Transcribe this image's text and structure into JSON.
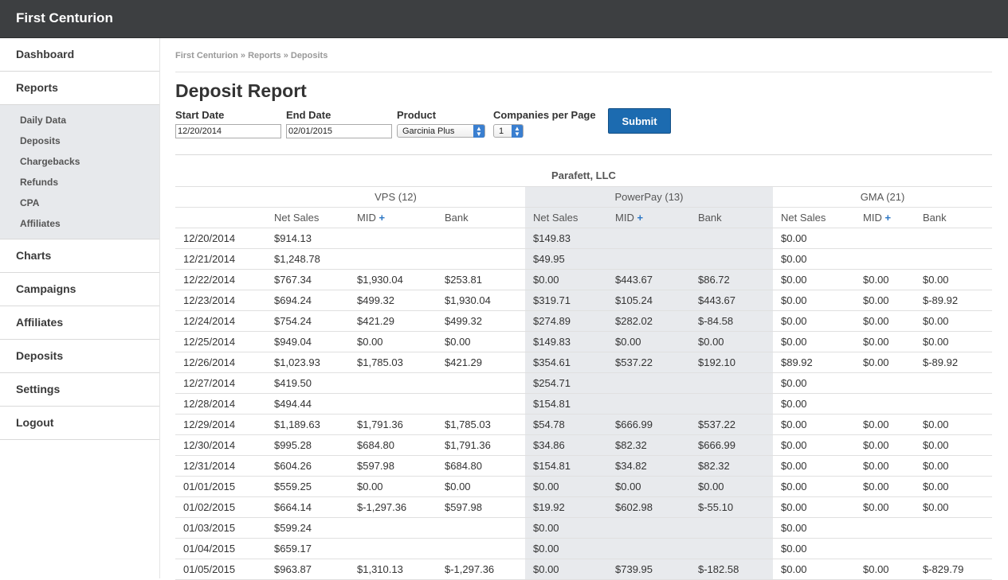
{
  "app": {
    "title": "First Centurion"
  },
  "sidebar": {
    "items": [
      {
        "label": "Dashboard"
      },
      {
        "label": "Reports"
      },
      {
        "label": "Charts"
      },
      {
        "label": "Campaigns"
      },
      {
        "label": "Affiliates"
      },
      {
        "label": "Deposits"
      },
      {
        "label": "Settings"
      },
      {
        "label": "Logout"
      }
    ],
    "subitems": [
      {
        "label": "Daily Data"
      },
      {
        "label": "Deposits"
      },
      {
        "label": "Chargebacks"
      },
      {
        "label": "Refunds"
      },
      {
        "label": "CPA"
      },
      {
        "label": "Affiliates"
      }
    ]
  },
  "breadcrumb": {
    "home": "First Centurion",
    "sep": " » ",
    "reports": "Reports",
    "current": "Deposits"
  },
  "page": {
    "title": "Deposit Report"
  },
  "filters": {
    "start_label": "Start Date",
    "start_value": "12/20/2014",
    "end_label": "End Date",
    "end_value": "02/01/2015",
    "product_label": "Product",
    "product_value": "Garcinia Plus",
    "companies_label": "Companies per Page",
    "companies_value": "1",
    "submit_label": "Submit"
  },
  "table": {
    "company": "Parafett, LLC",
    "groups": [
      "VPS (12)",
      "PowerPay (13)",
      "GMA (21)"
    ],
    "columns": {
      "net": "Net Sales",
      "mid": "MID",
      "plus": "+",
      "bank": "Bank"
    },
    "rows": [
      [
        "12/20/2014",
        "$914.13",
        "",
        "",
        "$149.83",
        "",
        "",
        "$0.00",
        "",
        ""
      ],
      [
        "12/21/2014",
        "$1,248.78",
        "",
        "",
        "$49.95",
        "",
        "",
        "$0.00",
        "",
        ""
      ],
      [
        "12/22/2014",
        "$767.34",
        "$1,930.04",
        "$253.81",
        "$0.00",
        "$443.67",
        "$86.72",
        "$0.00",
        "$0.00",
        "$0.00"
      ],
      [
        "12/23/2014",
        "$694.24",
        "$499.32",
        "$1,930.04",
        "$319.71",
        "$105.24",
        "$443.67",
        "$0.00",
        "$0.00",
        "$-89.92"
      ],
      [
        "12/24/2014",
        "$754.24",
        "$421.29",
        "$499.32",
        "$274.89",
        "$282.02",
        "$-84.58",
        "$0.00",
        "$0.00",
        "$0.00"
      ],
      [
        "12/25/2014",
        "$949.04",
        "$0.00",
        "$0.00",
        "$149.83",
        "$0.00",
        "$0.00",
        "$0.00",
        "$0.00",
        "$0.00"
      ],
      [
        "12/26/2014",
        "$1,023.93",
        "$1,785.03",
        "$421.29",
        "$354.61",
        "$537.22",
        "$192.10",
        "$89.92",
        "$0.00",
        "$-89.92"
      ],
      [
        "12/27/2014",
        "$419.50",
        "",
        "",
        "$254.71",
        "",
        "",
        "$0.00",
        "",
        ""
      ],
      [
        "12/28/2014",
        "$494.44",
        "",
        "",
        "$154.81",
        "",
        "",
        "$0.00",
        "",
        ""
      ],
      [
        "12/29/2014",
        "$1,189.63",
        "$1,791.36",
        "$1,785.03",
        "$54.78",
        "$666.99",
        "$537.22",
        "$0.00",
        "$0.00",
        "$0.00"
      ],
      [
        "12/30/2014",
        "$995.28",
        "$684.80",
        "$1,791.36",
        "$34.86",
        "$82.32",
        "$666.99",
        "$0.00",
        "$0.00",
        "$0.00"
      ],
      [
        "12/31/2014",
        "$604.26",
        "$597.98",
        "$684.80",
        "$154.81",
        "$34.82",
        "$82.32",
        "$0.00",
        "$0.00",
        "$0.00"
      ],
      [
        "01/01/2015",
        "$559.25",
        "$0.00",
        "$0.00",
        "$0.00",
        "$0.00",
        "$0.00",
        "$0.00",
        "$0.00",
        "$0.00"
      ],
      [
        "01/02/2015",
        "$664.14",
        "$-1,297.36",
        "$597.98",
        "$19.92",
        "$602.98",
        "$-55.10",
        "$0.00",
        "$0.00",
        "$0.00"
      ],
      [
        "01/03/2015",
        "$599.24",
        "",
        "",
        "$0.00",
        "",
        "",
        "$0.00",
        "",
        ""
      ],
      [
        "01/04/2015",
        "$659.17",
        "",
        "",
        "$0.00",
        "",
        "",
        "$0.00",
        "",
        ""
      ],
      [
        "01/05/2015",
        "$963.87",
        "$1,310.13",
        "$-1,297.36",
        "$0.00",
        "$739.95",
        "$-182.58",
        "$0.00",
        "$0.00",
        "$-829.79"
      ]
    ]
  }
}
